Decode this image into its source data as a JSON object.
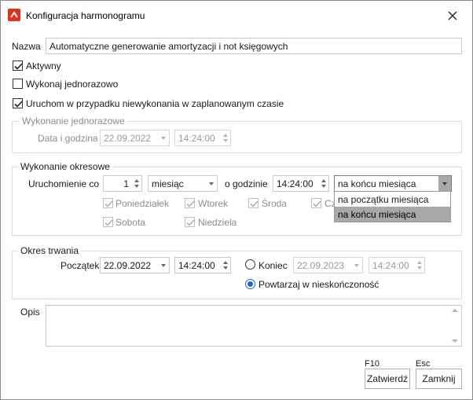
{
  "window": {
    "title": "Konfiguracja harmonogramu",
    "icon": "app-red-icon",
    "close_icon": "close-icon"
  },
  "name": {
    "label": "Nazwa",
    "value": "Automatyczne generowanie amortyzacji i not księgowych"
  },
  "options": {
    "active": {
      "label": "Aktywny",
      "checked": true
    },
    "once": {
      "label": "Wykonaj jednorazowo",
      "checked": false
    },
    "run_if_missed": {
      "label": "Uruchom w przypadku niewykonania w zaplanowanym czasie",
      "checked": true
    }
  },
  "one_time": {
    "title": "Wykonanie jednorazowe",
    "datetime_label": "Data i godzina",
    "date": "22.09.2022",
    "time": "14:24:00"
  },
  "periodic": {
    "title": "Wykonanie okresowe",
    "run_every_label": "Uruchomienie co",
    "interval_value": "1",
    "interval_unit": "miesiąc",
    "at_time_label": "o godzinie",
    "time": "14:24:00",
    "timing": "na końcu miesiąca",
    "timing_options": [
      "na początku miesiąca",
      "na końcu miesiąca"
    ],
    "days": [
      {
        "label": "Poniedziałek",
        "checked": true
      },
      {
        "label": "Wtorek",
        "checked": true
      },
      {
        "label": "Środa",
        "checked": true
      },
      {
        "label": "Cz",
        "checked": true
      },
      {
        "label": "Sobota",
        "checked": true
      },
      {
        "label": "Niedziela",
        "checked": true
      }
    ]
  },
  "duration": {
    "title": "Okres trwania",
    "start_label": "Początek",
    "start_date": "22.09.2022",
    "start_time": "14:24:00",
    "end_label": "Koniec",
    "end_date": "22.09.2023",
    "end_time": "14:24:00",
    "repeat_label": "Powtarzaj w nieskończoność",
    "selected": "repeat"
  },
  "description": {
    "label": "Opis",
    "value": ""
  },
  "buttons": {
    "confirm_shortcut": "F10",
    "confirm_label": "Zatwierdź",
    "close_shortcut": "Esc",
    "close_label": "Zamknij"
  },
  "colors": {
    "accent": "#2064c8",
    "dropdown_selected": "#a8a8a8",
    "app_icon": "#e0301e"
  }
}
